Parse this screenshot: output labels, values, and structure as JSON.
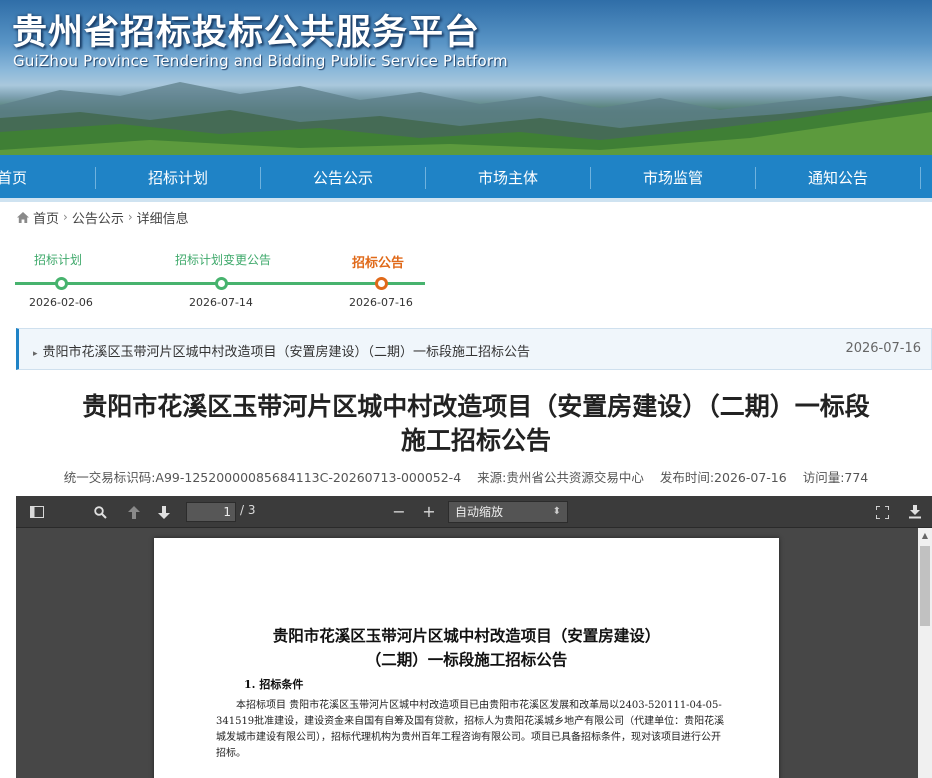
{
  "banner": {
    "title": "贵州省招标投标公共服务平台",
    "subtitle": "GuiZhou Province Tendering and Bidding Public Service Platform"
  },
  "nav": {
    "items": [
      "首页",
      "招标计划",
      "公告公示",
      "市场主体",
      "市场监管",
      "通知公告"
    ]
  },
  "breadcrumb": {
    "home": "首页",
    "section": "公告公示",
    "current": "详细信息"
  },
  "timeline": {
    "steps": [
      {
        "label": "招标计划",
        "date": "2026-02-06",
        "active": false
      },
      {
        "label": "招标计划变更公告",
        "date": "2026-07-14",
        "active": false
      },
      {
        "label": "招标公告",
        "date": "2026-07-16",
        "active": true
      }
    ]
  },
  "notice": {
    "text": "贵阳市花溪区玉带河片区城中村改造项目（安置房建设）（二期）一标段施工招标公告",
    "date": "2026-07-16"
  },
  "article": {
    "title_line1": "贵阳市花溪区玉带河片区城中村改造项目（安置房建设）（二期）一标段",
    "title_line2": "施工招标公告",
    "meta": {
      "code": "统一交易标识码:A99-12520000085684113C-20260713-000052-4",
      "source": "来源:贵州省公共资源交易中心",
      "published": "发布时间:2026-07-16",
      "views": "访问量:774"
    }
  },
  "viewer": {
    "page_current": "1",
    "page_total": "/ 3",
    "zoom": "自动缩放",
    "pdf": {
      "title_line1": "贵阳市花溪区玉带河片区城中村改造项目（安置房建设）",
      "title_line2": "（二期）一标段施工招标公告",
      "heading": "1. 招标条件",
      "body": "本招标项目 贵阳市花溪区玉带河片区城中村改造项目已由贵阳市花溪区发展和改革局以2403-520111-04-05-341519批准建设，建设资金来自国有自筹及国有贷款，招标人为贵阳花溪城乡地产有限公司（代建单位：贵阳花溪城发城市建设有限公司），招标代理机构为贵州百年工程咨询有限公司。项目已具备招标条件，现对该项目进行公开招标。"
    }
  },
  "colors": {
    "nav_bg": "#1f83c6",
    "timeline_green": "#47b36e",
    "timeline_active": "#e06a1a"
  }
}
